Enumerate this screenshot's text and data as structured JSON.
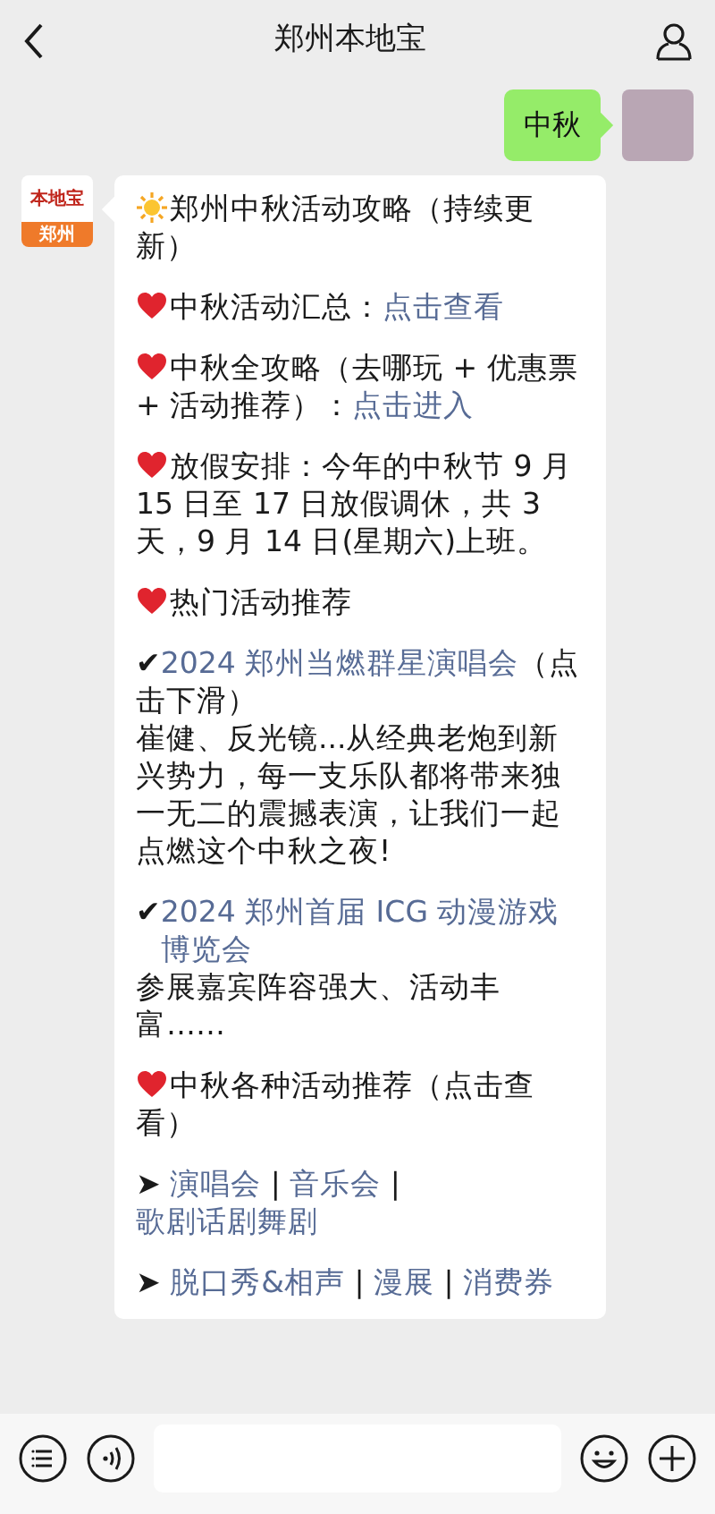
{
  "header": {
    "title": "郑州本地宝"
  },
  "sent": {
    "text": "中秋"
  },
  "received": {
    "logo": {
      "brand": "本地宝",
      "city": "郑州"
    },
    "paragraphs": [
      {
        "kind": "sun",
        "lines": [
          [
            {
              "kind": "text",
              "text": "郑州中秋活动攻略（持续更新）"
            }
          ]
        ]
      },
      {
        "kind": "heart",
        "lines": [
          [
            {
              "kind": "text",
              "text": "中秋活动汇总："
            },
            {
              "kind": "link",
              "text": "点击查看"
            }
          ]
        ]
      },
      {
        "kind": "heart",
        "lines": [
          [
            {
              "kind": "text",
              "text": "中秋全攻略（去哪玩 + 优惠票 + 活动推荐）："
            },
            {
              "kind": "link",
              "text": "点击进入"
            }
          ]
        ]
      },
      {
        "kind": "heart",
        "lines": [
          [
            {
              "kind": "text",
              "text": "放假安排：今年的中秋节 9 月 15 日至 17 日放假调休，共 3 天，9 月 14 日(星期六)上班。"
            }
          ]
        ]
      },
      {
        "kind": "heart",
        "lines": [
          [
            {
              "kind": "text",
              "text": "热门活动推荐"
            }
          ]
        ]
      },
      {
        "kind": "plain",
        "lines": [
          [
            {
              "kind": "text",
              "text": "✔"
            },
            {
              "kind": "link",
              "text": "2024 郑州当燃群星演唱会"
            },
            {
              "kind": "text",
              "text": "（点击下滑）"
            }
          ],
          [
            {
              "kind": "text",
              "text": "崔健、反光镜...从经典老炮到新兴势力，每一支乐队都将带来独一无二的震撼表演，让我们一起点燃这个中秋之夜!"
            }
          ]
        ]
      },
      {
        "kind": "plain",
        "lines": [
          [
            {
              "kind": "text",
              "text": "✔"
            },
            {
              "kind": "link",
              "text": "2024 郑州首届 ICG 动漫游戏博览会"
            }
          ],
          [
            {
              "kind": "text",
              "text": "参展嘉宾阵容强大、活动丰富……"
            }
          ]
        ]
      },
      {
        "kind": "heart",
        "lines": [
          [
            {
              "kind": "text",
              "text": "中秋各种活动推荐（点击查看）"
            }
          ]
        ]
      },
      {
        "kind": "plain",
        "lines": [
          [
            {
              "kind": "text",
              "text": "➤ "
            },
            {
              "kind": "link",
              "text": "演唱会"
            },
            {
              "kind": "text",
              "text": " | "
            },
            {
              "kind": "link",
              "text": "音乐会"
            },
            {
              "kind": "text",
              "text": " | "
            },
            {
              "kind": "link",
              "text": "歌剧话剧舞剧"
            }
          ]
        ]
      },
      {
        "kind": "plain",
        "lines": [
          [
            {
              "kind": "text",
              "text": "➤ "
            },
            {
              "kind": "link",
              "text": "脱口秀&相声"
            },
            {
              "kind": "text",
              "text": " |  "
            },
            {
              "kind": "link",
              "text": "漫展"
            },
            {
              "kind": "text",
              "text": " |  "
            },
            {
              "kind": "link",
              "text": "消费券"
            }
          ]
        ]
      }
    ]
  }
}
